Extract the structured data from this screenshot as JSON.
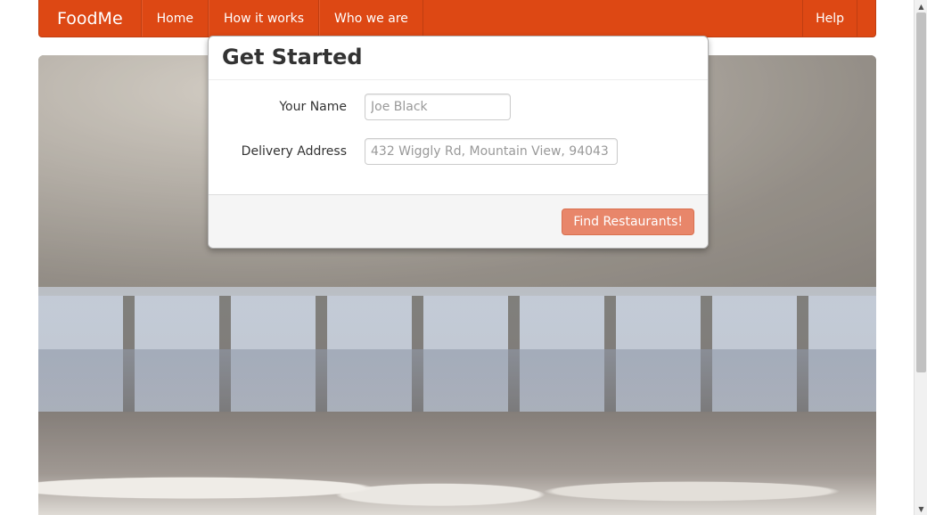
{
  "navbar": {
    "brand": "FoodMe",
    "items": [
      {
        "label": "Home"
      },
      {
        "label": "How it works"
      },
      {
        "label": "Who we are"
      }
    ],
    "right_item": "Help",
    "color": "#dd4814"
  },
  "modal": {
    "title": "Get Started",
    "name_label": "Your Name",
    "name_placeholder": "Joe Black",
    "address_label": "Delivery Address",
    "address_placeholder": "432 Wiggly Rd, Mountain View, 94043",
    "submit_label": "Find Restaurants!"
  },
  "scrollbar": {
    "up_icon": "triangle-up-icon",
    "down_icon": "triangle-down-icon"
  }
}
